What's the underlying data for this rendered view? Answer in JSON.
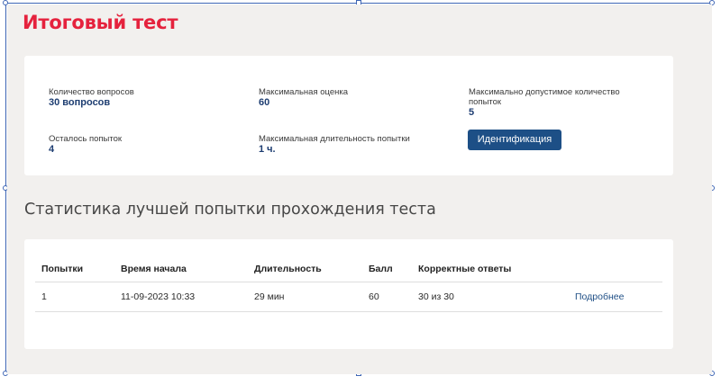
{
  "page": {
    "title": "Итоговый тест"
  },
  "summary": {
    "questions_label": "Количество вопросов",
    "questions_value": "30 вопросов",
    "max_score_label": "Максимальная оценка",
    "max_score_value": "60",
    "max_attempts_label_line1": "Максимально допустимое количество",
    "max_attempts_label_line2": "попыток",
    "max_attempts_value": "5",
    "attempts_left_label": "Осталось попыток",
    "attempts_left_value": "4",
    "max_duration_label": "Максимальная длительность попытки",
    "max_duration_value": "1 ч.",
    "identify_button": "Идентификация"
  },
  "stats": {
    "section_title": "Статистика лучшей попытки прохождения теста",
    "columns": [
      "Попытки",
      "Время начала",
      "Длительность",
      "Балл",
      "Корректные ответы"
    ],
    "rows": [
      {
        "attempt": "1",
        "start_time": "11-09-2023 10:33",
        "duration": "29 мин",
        "score": "60",
        "correct": "30 из 30",
        "details_link": "Подробнее"
      }
    ]
  },
  "colors": {
    "title": "#e5223d",
    "value": "#1d3d71",
    "button": "#1d4f86",
    "link": "#1f4f86",
    "background": "#f2f0ee"
  }
}
